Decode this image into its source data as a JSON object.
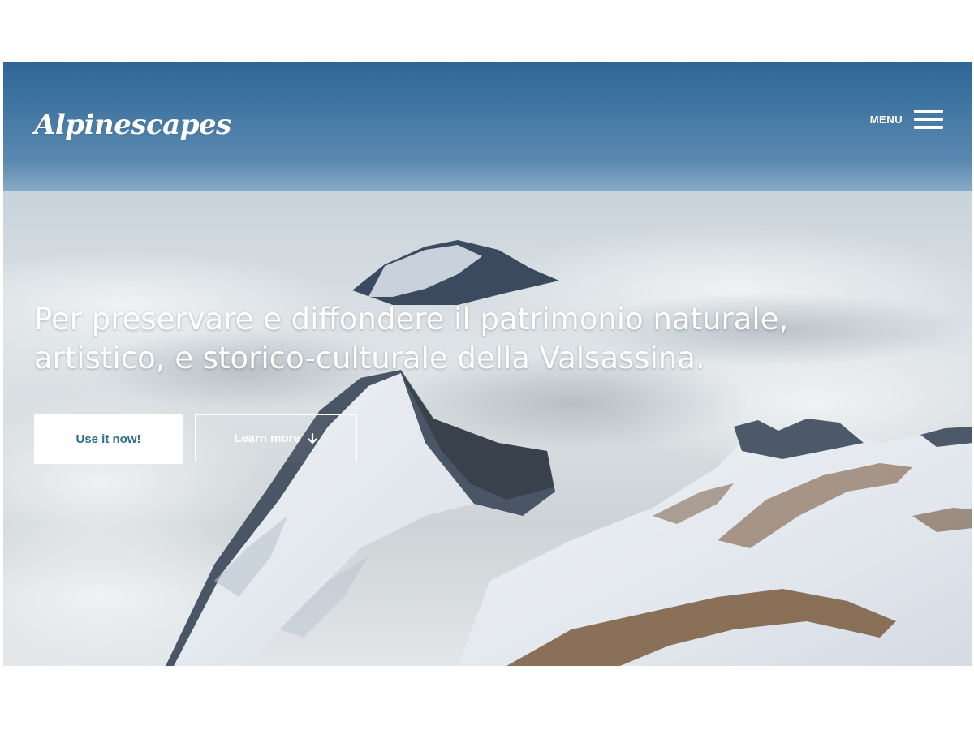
{
  "brand": {
    "logo_text": "Alpinescapes"
  },
  "nav": {
    "menu_label": "MENU",
    "menu_icon": "hamburger-icon"
  },
  "hero": {
    "headline_line1": "Per preservare e diffondere il patrimonio naturale,",
    "headline_line2": "artistico, e storico-culturale della Valsassina.",
    "primary_cta": "Use it now!",
    "secondary_cta": "Learn more",
    "secondary_cta_icon": "arrow-down-icon",
    "background": "snowy-mountain-above-clouds"
  },
  "colors": {
    "primary_button_text": "#2c6e8a",
    "sky_top": "#2f6a9a",
    "sky_bottom": "#8fb3cc",
    "text": "#ffffff"
  }
}
